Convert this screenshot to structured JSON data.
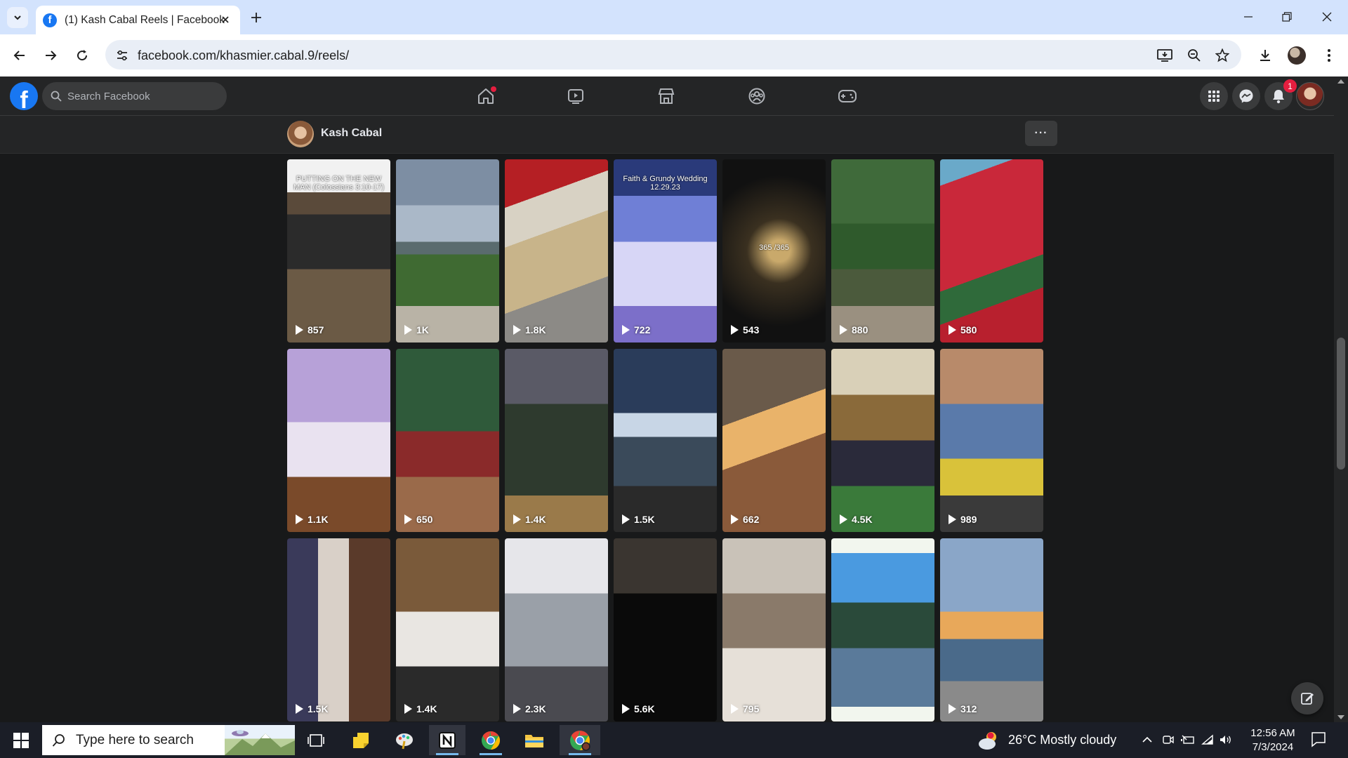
{
  "browser": {
    "tab_title": "(1) Kash Cabal Reels | Facebook",
    "url": "facebook.com/khasmier.cabal.9/reels/"
  },
  "facebook": {
    "search_placeholder": "Search Facebook",
    "notification_count": "1"
  },
  "profile": {
    "name": "Kash Cabal",
    "more_label": "···"
  },
  "reels": [
    {
      "count": "857",
      "overlay": "PUTTING ON THE NEW MAN (Colossians 3:10-17)"
    },
    {
      "count": "1K",
      "overlay": ""
    },
    {
      "count": "1.8K",
      "overlay": ""
    },
    {
      "count": "722",
      "overlay": "Faith & Grundy Wedding 12.29.23"
    },
    {
      "count": "543",
      "overlay": "365 /365"
    },
    {
      "count": "880",
      "overlay": ""
    },
    {
      "count": "580",
      "overlay": ""
    },
    {
      "count": "1.1K",
      "overlay": ""
    },
    {
      "count": "650",
      "overlay": ""
    },
    {
      "count": "1.4K",
      "overlay": ""
    },
    {
      "count": "1.5K",
      "overlay": ""
    },
    {
      "count": "662",
      "overlay": ""
    },
    {
      "count": "4.5K",
      "overlay": ""
    },
    {
      "count": "989",
      "overlay": ""
    },
    {
      "count": "1.5K",
      "overlay": ""
    },
    {
      "count": "1.4K",
      "overlay": ""
    },
    {
      "count": "2.3K",
      "overlay": ""
    },
    {
      "count": "5.6K",
      "overlay": ""
    },
    {
      "count": "795",
      "overlay": ""
    },
    {
      "count": "",
      "overlay": ""
    },
    {
      "count": "312",
      "overlay": ""
    }
  ],
  "taskbar": {
    "search_placeholder": "Type here to search",
    "weather": "26°C  Mostly cloudy",
    "time": "12:56 AM",
    "date": "7/3/2024"
  },
  "colors": {
    "fb_blue": "#1877f2",
    "fb_surface": "#242526",
    "fb_background": "#18191a",
    "badge_red": "#e41e3f"
  }
}
